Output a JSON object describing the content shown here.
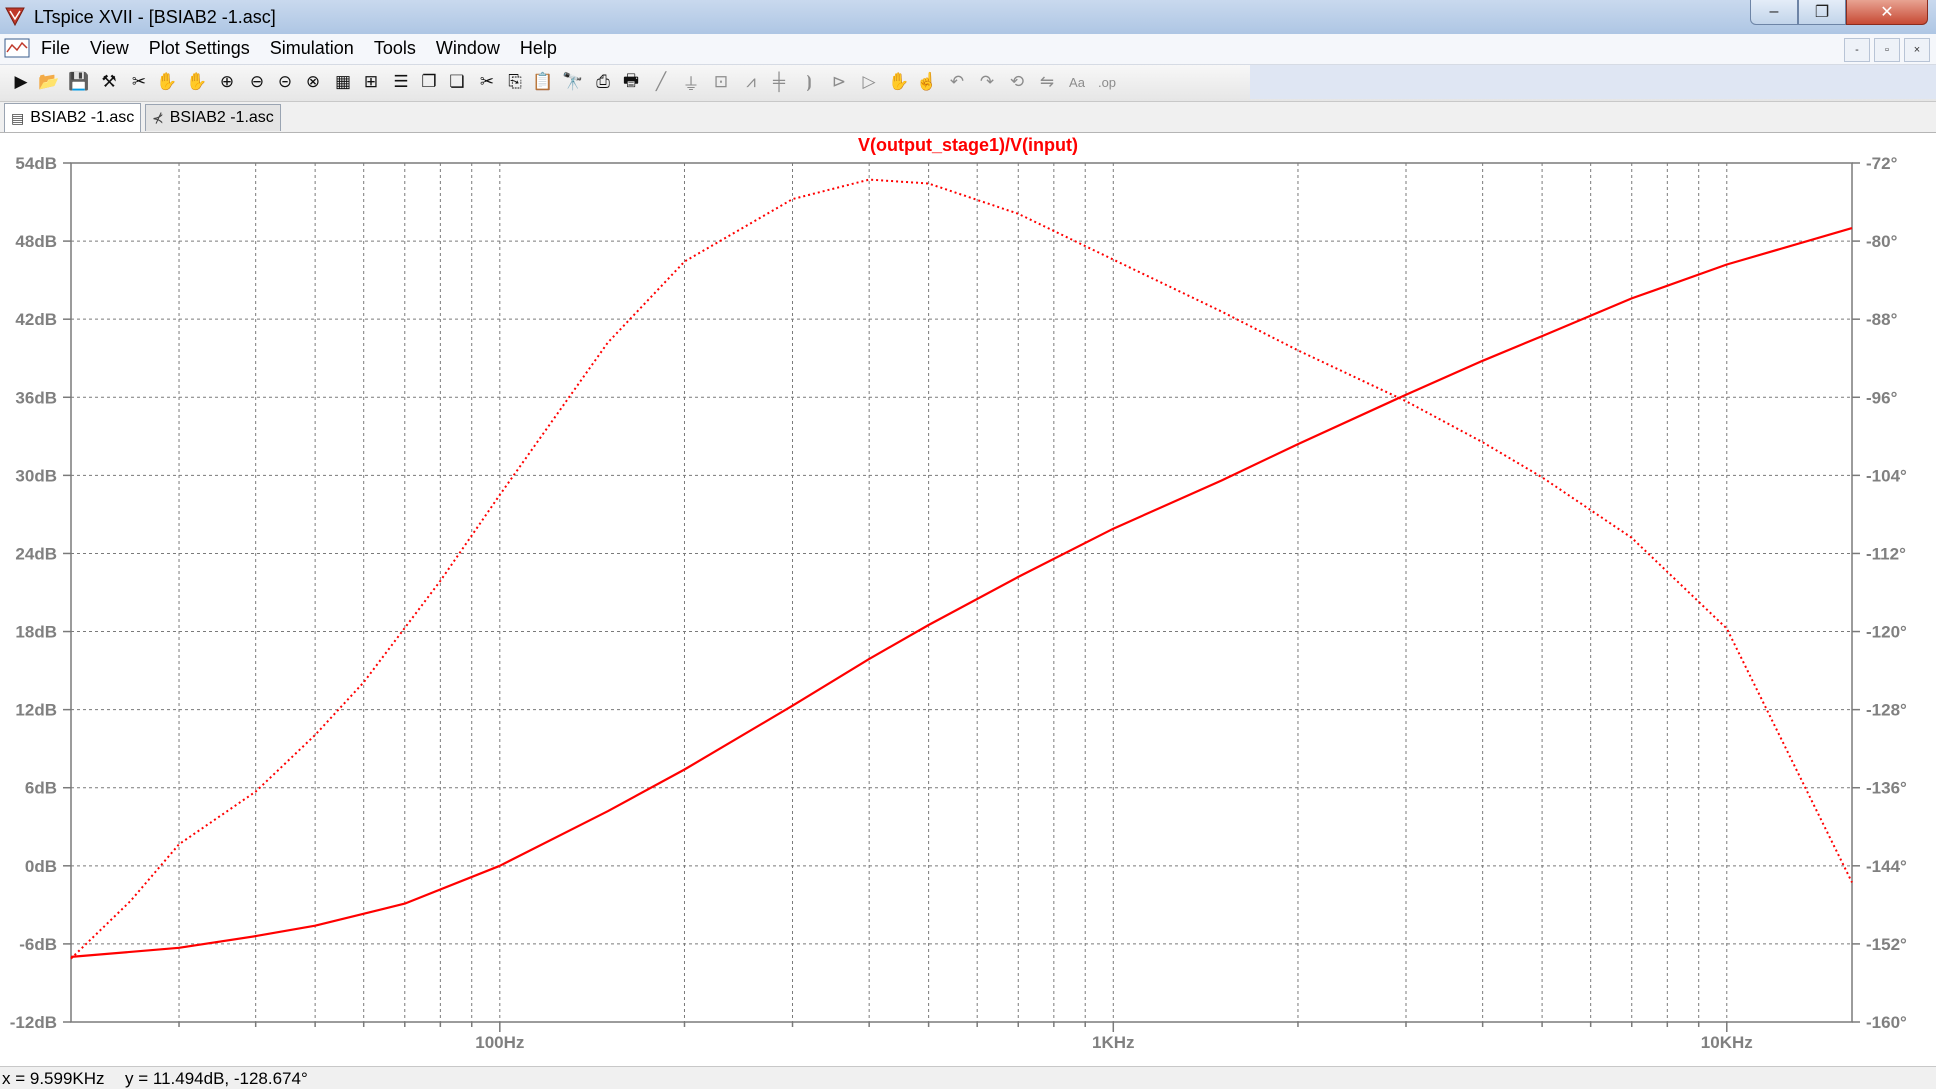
{
  "window": {
    "title": "LTspice XVII - [BSIAB2 -1.asc]",
    "buttons": {
      "minimize": "–",
      "maximize": "❐",
      "close": "✕"
    }
  },
  "menu": {
    "items": [
      "File",
      "View",
      "Plot Settings",
      "Simulation",
      "Tools",
      "Window",
      "Help"
    ],
    "mdi_buttons": [
      "-",
      "▫",
      "×"
    ]
  },
  "toolbar": {
    "icons": [
      "new-schematic-icon",
      "open-icon",
      "save-icon",
      "control-panel-icon",
      "run-icon",
      "halt-icon",
      "pan-icon",
      "zoom-in-icon",
      "zoom-out-icon",
      "zoom-fit-icon",
      "zoom-full-icon",
      "autorange-icon",
      "mark-unmark-icon",
      "tile-horizontal-icon",
      "cascade-icon",
      "tile-vertical-icon",
      "cut-icon",
      "copy-icon",
      "paste-icon",
      "find-icon",
      "print-setup-icon",
      "print-icon",
      "wire-icon",
      "ground-icon",
      "label-icon",
      "resistor-icon",
      "capacitor-icon",
      "inductor-icon",
      "diode-icon",
      "component-icon",
      "move-icon",
      "drag-icon",
      "undo-icon",
      "redo-icon",
      "rotate-icon",
      "mirror-icon",
      "text-icon",
      "spice-directive-icon"
    ]
  },
  "tabs": [
    {
      "label": "BSIAB2 -1.asc",
      "icon": "waveform-icon",
      "active": true
    },
    {
      "label": "BSIAB2 -1.asc",
      "icon": "schematic-icon",
      "active": false
    }
  ],
  "status": {
    "x_readout": "x = 9.599KHz",
    "y_readout": "y = 11.494dB, -128.674°"
  },
  "colors": {
    "trace": "#ff0000",
    "grid": "#7a7a7a",
    "axis_text": "#808080"
  },
  "chart_data": {
    "type": "line",
    "title": "V(output_stage1)/V(input)",
    "x_scale": "log",
    "xlim": [
      20,
      16000
    ],
    "x_ticks": [
      100,
      1000,
      10000
    ],
    "x_tick_labels": [
      "100Hz",
      "1KHz",
      "10KHz"
    ],
    "ylim_left": [
      -12,
      54
    ],
    "y_ticks_left": [
      54,
      48,
      42,
      36,
      30,
      24,
      18,
      12,
      6,
      0,
      -6,
      -12
    ],
    "y_tick_labels_left": [
      "54dB",
      "48dB",
      "42dB",
      "36dB",
      "30dB",
      "24dB",
      "18dB",
      "12dB",
      "6dB",
      "0dB",
      "-6dB",
      "-12dB"
    ],
    "ylim_right": [
      -160,
      -72
    ],
    "y_ticks_right": [
      -72,
      -80,
      -88,
      -96,
      -104,
      -112,
      -120,
      -128,
      -136,
      -144,
      -152,
      -160
    ],
    "y_tick_labels_right": [
      "-72°",
      "-80°",
      "-88°",
      "-96°",
      "-104°",
      "-112°",
      "-120°",
      "-128°",
      "-136°",
      "-144°",
      "-152°",
      "-160°"
    ],
    "grid": true,
    "series": [
      {
        "axis": "left",
        "style": "solid",
        "x": [
          20,
          30,
          40,
          50,
          70,
          100,
          150,
          200,
          300,
          400,
          500,
          700,
          1000,
          1500,
          2000,
          3000,
          4000,
          5000,
          7000,
          10000,
          16000
        ],
        "y": [
          -7,
          -6.3,
          -5.4,
          -4.6,
          -2.9,
          0,
          4.2,
          7.4,
          12.3,
          15.9,
          18.5,
          22.2,
          25.9,
          29.6,
          32.4,
          36.2,
          38.8,
          40.7,
          43.6,
          46.2,
          49
        ]
      },
      {
        "axis": "right",
        "style": "dotted",
        "x": [
          20,
          25,
          30,
          40,
          50,
          60,
          80,
          100,
          150,
          200,
          300,
          400,
          500,
          700,
          1000,
          1500,
          2000,
          3000,
          4000,
          5000,
          7000,
          10000,
          16000
        ],
        "y": [
          -153.5,
          -147.6,
          -141.8,
          -136.4,
          -130.6,
          -125.2,
          -114.8,
          -106,
          -90.4,
          -82.1,
          -75.7,
          -73.7,
          -74.1,
          -77.2,
          -81.9,
          -87.2,
          -91.2,
          -96.4,
          -100.6,
          -104.2,
          -110.4,
          -119.7,
          -145.7
        ]
      }
    ]
  }
}
